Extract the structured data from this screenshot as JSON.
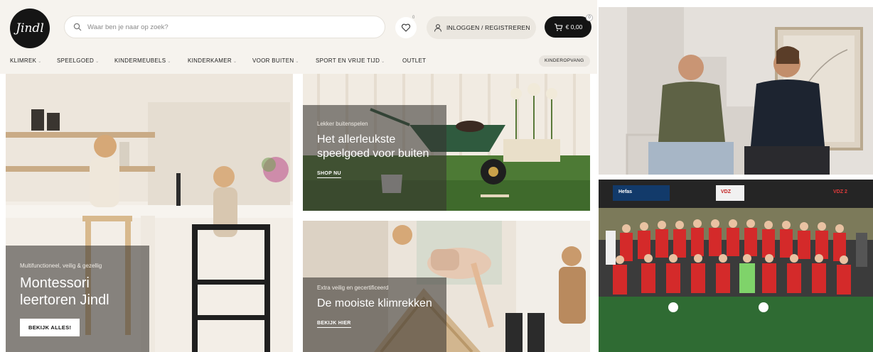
{
  "header": {
    "logo_text": "Jindl",
    "search_placeholder": "Waar ben je naar op zoek?",
    "wishlist_count": "0",
    "login_label": "INLOGGEN / REGISTREREN",
    "cart_total": "€ 0,00",
    "cart_count": "0"
  },
  "nav": {
    "items": [
      {
        "label": "KLIMREK"
      },
      {
        "label": "SPEELGOED"
      },
      {
        "label": "KINDERMEUBELS"
      },
      {
        "label": "KINDERKAMER"
      },
      {
        "label": "VOOR BUITEN"
      },
      {
        "label": "SPORT EN VRIJE TIJD"
      },
      {
        "label": "OUTLET"
      }
    ],
    "pill_label": "KINDEROPVANG"
  },
  "banners": {
    "b1": {
      "subtitle": "Multifunctioneel, veilig & gezellig",
      "title": "Montessori leertoren Jindl",
      "cta": "BEKIJK ALLES!"
    },
    "b2": {
      "subtitle": "Lekker buitenspelen",
      "title": "Het allerleukste speelgoed voor buiten",
      "cta": "SHOP NU"
    },
    "b3": {
      "subtitle": "Extra veilig en gecertificeerd",
      "title": "De mooiste klimrekken",
      "cta": "BEKIJK HIER"
    }
  },
  "team_photo": {
    "sponsor_left": "Hefas",
    "sponsor_mid": "VDZ",
    "sponsor_right": "VDZ 2"
  },
  "colors": {
    "header_bg": "#f6f3ee",
    "cart_bg": "#141414",
    "overlay": "#37342f",
    "jersey_red": "#d42a2a",
    "pitch_green": "#2a5a2a"
  }
}
